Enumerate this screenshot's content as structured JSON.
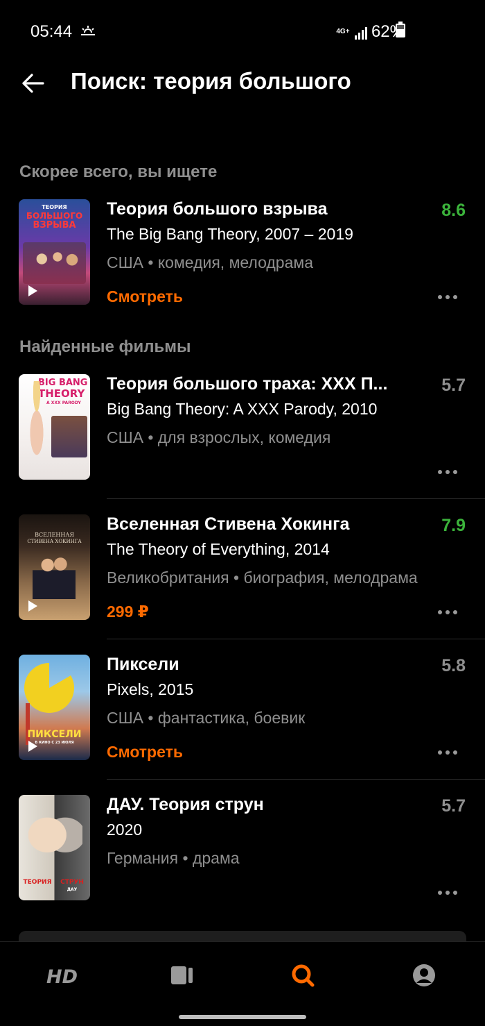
{
  "status_bar": {
    "time": "05:44",
    "network": "4G+",
    "battery": "62%"
  },
  "header": {
    "title": "Поиск: теория большого"
  },
  "sections": [
    {
      "title": "Скорее всего, вы ищете"
    },
    {
      "title": "Найденные фильмы"
    }
  ],
  "results": [
    {
      "title": "Теория большого взрыва",
      "subtitle": "The Big Bang Theory, 2007 – 2019",
      "meta": "США • комедия, мелодрама",
      "action": "Смотреть",
      "rating": "8.6",
      "rating_color": "#3bb33b",
      "poster_text": [
        "ТЕОРИЯ",
        "БОЛЬШОГО",
        "ВЗРЫВА"
      ]
    },
    {
      "title": "Теория большого траха: XXX П...",
      "subtitle": "Big Bang Theory: A XXX Parody, 2010",
      "meta": "США • для взрослых, комедия",
      "action": "",
      "rating": "5.7",
      "rating_color": "#8f8f8f",
      "poster_text": [
        "BIG BANG",
        "THEORY",
        "A XXX PARODY"
      ]
    },
    {
      "title": "Вселенная Стивена Хокинга",
      "subtitle": "The Theory of Everything, 2014",
      "meta": "Великобритания • биография, мелодрама",
      "action": "299 ₽",
      "rating": "7.9",
      "rating_color": "#3bb33b",
      "poster_text": [
        "ВСЕЛЕННАЯ",
        "СТИВЕНА ХОКИНГА"
      ]
    },
    {
      "title": "Пиксели",
      "subtitle": "Pixels, 2015",
      "meta": "США • фантастика, боевик",
      "action": "Смотреть",
      "rating": "5.8",
      "rating_color": "#8f8f8f",
      "poster_text": [
        "ПИКСЕЛИ",
        "В КИНО С 23 ИЮЛЯ"
      ]
    },
    {
      "title": "ДАУ. Теория струн",
      "subtitle": "2020",
      "meta": "Германия • драма",
      "action": "",
      "rating": "5.7",
      "rating_color": "#8f8f8f",
      "poster_text": [
        "ТЕОРИЯ",
        "СТРУН",
        "ДАУ"
      ]
    }
  ],
  "tabbar": {
    "items": [
      {
        "icon": "hd-icon"
      },
      {
        "icon": "library-icon"
      },
      {
        "icon": "search-icon",
        "active": true,
        "color": "#ff6a00"
      },
      {
        "icon": "profile-icon"
      }
    ]
  },
  "colors": {
    "accent": "#ff6a00",
    "rating_high": "#3bb33b",
    "secondary_text": "#8f8f8f"
  }
}
